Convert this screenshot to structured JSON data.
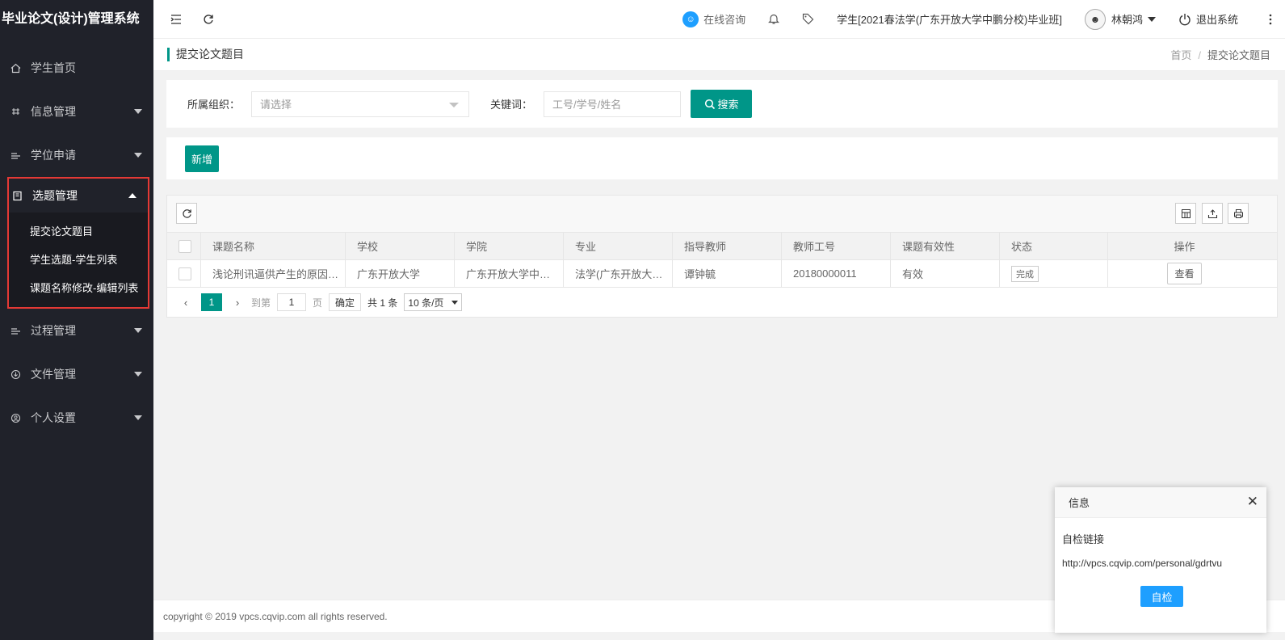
{
  "app": {
    "title": "毕业论文(设计)管理系统"
  },
  "sidebar": {
    "items": [
      {
        "label": "学生首页",
        "icon": "home-icon"
      },
      {
        "label": "信息管理",
        "icon": "info-icon"
      },
      {
        "label": "学位申请",
        "icon": "degree-icon"
      },
      {
        "label": "选题管理",
        "icon": "topic-icon"
      },
      {
        "label": "过程管理",
        "icon": "process-icon"
      },
      {
        "label": "文件管理",
        "icon": "file-icon"
      },
      {
        "label": "个人设置",
        "icon": "user-settings-icon"
      }
    ],
    "sub_items": [
      "提交论文题目",
      "学生选题-学生列表",
      "课题名称修改-编辑列表"
    ]
  },
  "header": {
    "consult": "在线咨询",
    "class_info": "学生[2021春法学(广东开放大学中鹏分校)毕业班]",
    "user_name": "林朝鸿",
    "logout": "退出系统"
  },
  "breadcrumb": {
    "page_title": "提交论文题目",
    "home": "首页",
    "sep": "/",
    "current": "提交论文题目"
  },
  "search": {
    "org_label": "所属组织：",
    "org_placeholder": "请选择",
    "keyword_label": "关键词：",
    "keyword_placeholder": "工号/学号/姓名",
    "search_button": "搜索"
  },
  "toolbar": {
    "add_button": "新增"
  },
  "table": {
    "columns": [
      "课题名称",
      "学校",
      "学院",
      "专业",
      "指导教师",
      "教师工号",
      "课题有效性",
      "状态",
      "操作"
    ],
    "rows": [
      {
        "title": "浅论刑讯逼供产生的原因…",
        "school": "广东开放大学",
        "college": "广东开放大学中…",
        "major": "法学(广东开放大…",
        "advisor": "谭钟毓",
        "advisor_id": "20180000011",
        "validity": "有效",
        "status": "完成",
        "action": "查看"
      }
    ]
  },
  "pagination": {
    "current_page": "1",
    "goto_label": "到第",
    "goto_value": "1",
    "page_unit": "页",
    "confirm": "确定",
    "total": "共 1 条",
    "page_size": "10 条/页"
  },
  "footer": {
    "copyright": "copyright © 2019 vpcs.cqvip.com all rights reserved."
  },
  "popup": {
    "title": "信息",
    "label": "自检链接",
    "link": "http://vpcs.cqvip.com/personal/gdrtvu",
    "button": "自检"
  },
  "colors": {
    "accent": "#009688",
    "sidebar_bg": "#20222a",
    "highlight_border": "#e53935",
    "popup_button": "#1e9fff"
  }
}
